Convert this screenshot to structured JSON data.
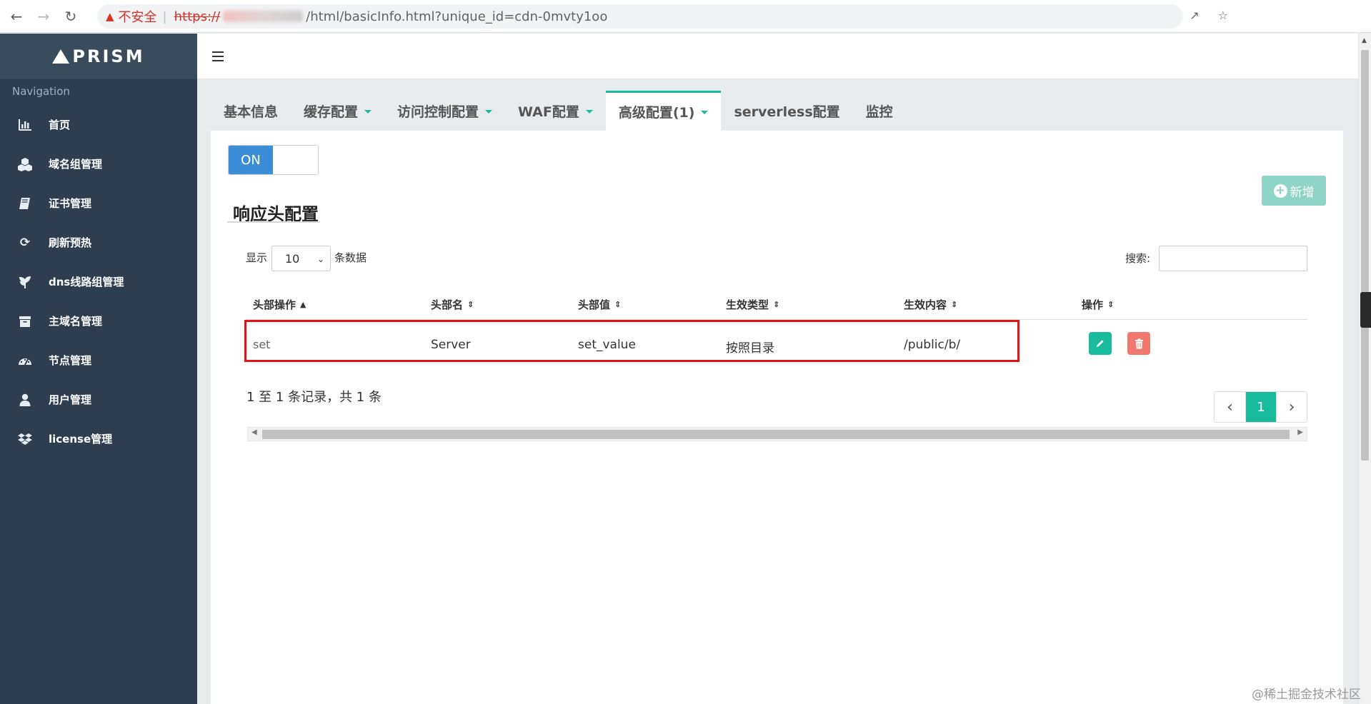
{
  "browser": {
    "security_label": "不安全",
    "url_scheme": "https://",
    "url_rest": "/html/basicInfo.html?unique_id=cdn-0mvty1oo"
  },
  "sidebar": {
    "logo_text": "PRISM",
    "nav_title": "Navigation",
    "items": [
      {
        "label": "首页",
        "icon": "bar-chart-icon"
      },
      {
        "label": "域名组管理",
        "icon": "cubes-icon"
      },
      {
        "label": "证书管理",
        "icon": "book-icon"
      },
      {
        "label": "刷新预热",
        "icon": "refresh-icon"
      },
      {
        "label": "dns线路组管理",
        "icon": "leaf-icon"
      },
      {
        "label": "主域名管理",
        "icon": "archive-icon"
      },
      {
        "label": "节点管理",
        "icon": "dashboard-icon"
      },
      {
        "label": "用户管理",
        "icon": "user-icon"
      },
      {
        "label": "license管理",
        "icon": "dropbox-icon"
      }
    ]
  },
  "tabs": [
    {
      "label": "基本信息",
      "dropdown": false,
      "active": false
    },
    {
      "label": "缓存配置",
      "dropdown": true,
      "active": false
    },
    {
      "label": "访问控制配置",
      "dropdown": true,
      "active": false
    },
    {
      "label": "WAF配置",
      "dropdown": true,
      "active": false
    },
    {
      "label": "高级配置(1)",
      "dropdown": true,
      "active": true
    },
    {
      "label": "serverless配置",
      "dropdown": false,
      "active": false
    },
    {
      "label": "监控",
      "dropdown": false,
      "active": false
    }
  ],
  "toggle": {
    "label": "ON",
    "state": "on"
  },
  "add_button": {
    "label": "新增",
    "icon": "plus-circle-icon"
  },
  "section_title": "响应头配置",
  "length_menu": {
    "prefix": "显示",
    "value": "10",
    "suffix": "条数据"
  },
  "search": {
    "label": "搜索:",
    "value": ""
  },
  "table": {
    "columns": [
      "头部操作",
      "头部名",
      "头部值",
      "生效类型",
      "生效内容",
      "操作"
    ],
    "sorted_column": "头部操作",
    "rows": [
      {
        "op": "set",
        "name": "Server",
        "value": "set_value",
        "type": "按照目录",
        "content": "/public/b/"
      }
    ]
  },
  "info_text": "1 至 1 条记录，共 1 条",
  "pagination": {
    "prev": "‹",
    "current": "1",
    "next": "›"
  },
  "watermark": "@稀土掘金技术社区",
  "colors": {
    "accent": "#1abb9c",
    "sidebar": "#2f3e4e",
    "toggle_on": "#3c8dd7",
    "delete": "#f0786e",
    "highlight_box": "#e01414"
  }
}
